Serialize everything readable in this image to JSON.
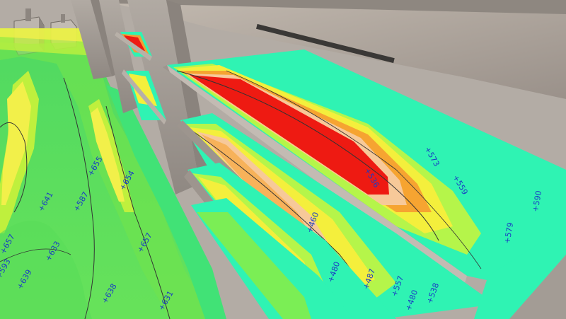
{
  "scene": {
    "colors": {
      "sky": "#b9b1a8",
      "structure": "#a39c95",
      "structure_dark": "#7a736c",
      "ground_green": "#52de6a",
      "cyan": "#2ff3b3",
      "green": "#5be04e",
      "lime": "#b6f23a",
      "yellow": "#f4ef3c",
      "orange": "#f6a431",
      "red": "#ee1a12",
      "label": "#1a3cc4"
    },
    "labels": [
      {
        "id": "l1",
        "text": "+657"
      },
      {
        "id": "l2",
        "text": "+633"
      },
      {
        "id": "l3",
        "text": "+639"
      },
      {
        "id": "l4",
        "text": "+638"
      },
      {
        "id": "l5",
        "text": "+631"
      },
      {
        "id": "l6",
        "text": "+657"
      },
      {
        "id": "l7",
        "text": "+593"
      },
      {
        "id": "l8",
        "text": "+587"
      },
      {
        "id": "l9",
        "text": "+536"
      },
      {
        "id": "l10",
        "text": "+480"
      },
      {
        "id": "l11",
        "text": "+460"
      },
      {
        "id": "l12",
        "text": "+480"
      },
      {
        "id": "l13",
        "text": "+487"
      },
      {
        "id": "l14",
        "text": "+538"
      },
      {
        "id": "l15",
        "text": "+557"
      },
      {
        "id": "l16",
        "text": "+573"
      },
      {
        "id": "l17",
        "text": "+579"
      },
      {
        "id": "l18",
        "text": "+590"
      },
      {
        "id": "l19",
        "text": "+655"
      },
      {
        "id": "l20",
        "text": "+641"
      },
      {
        "id": "l21",
        "text": "+654"
      },
      {
        "id": "l22",
        "text": "+559"
      }
    ]
  }
}
